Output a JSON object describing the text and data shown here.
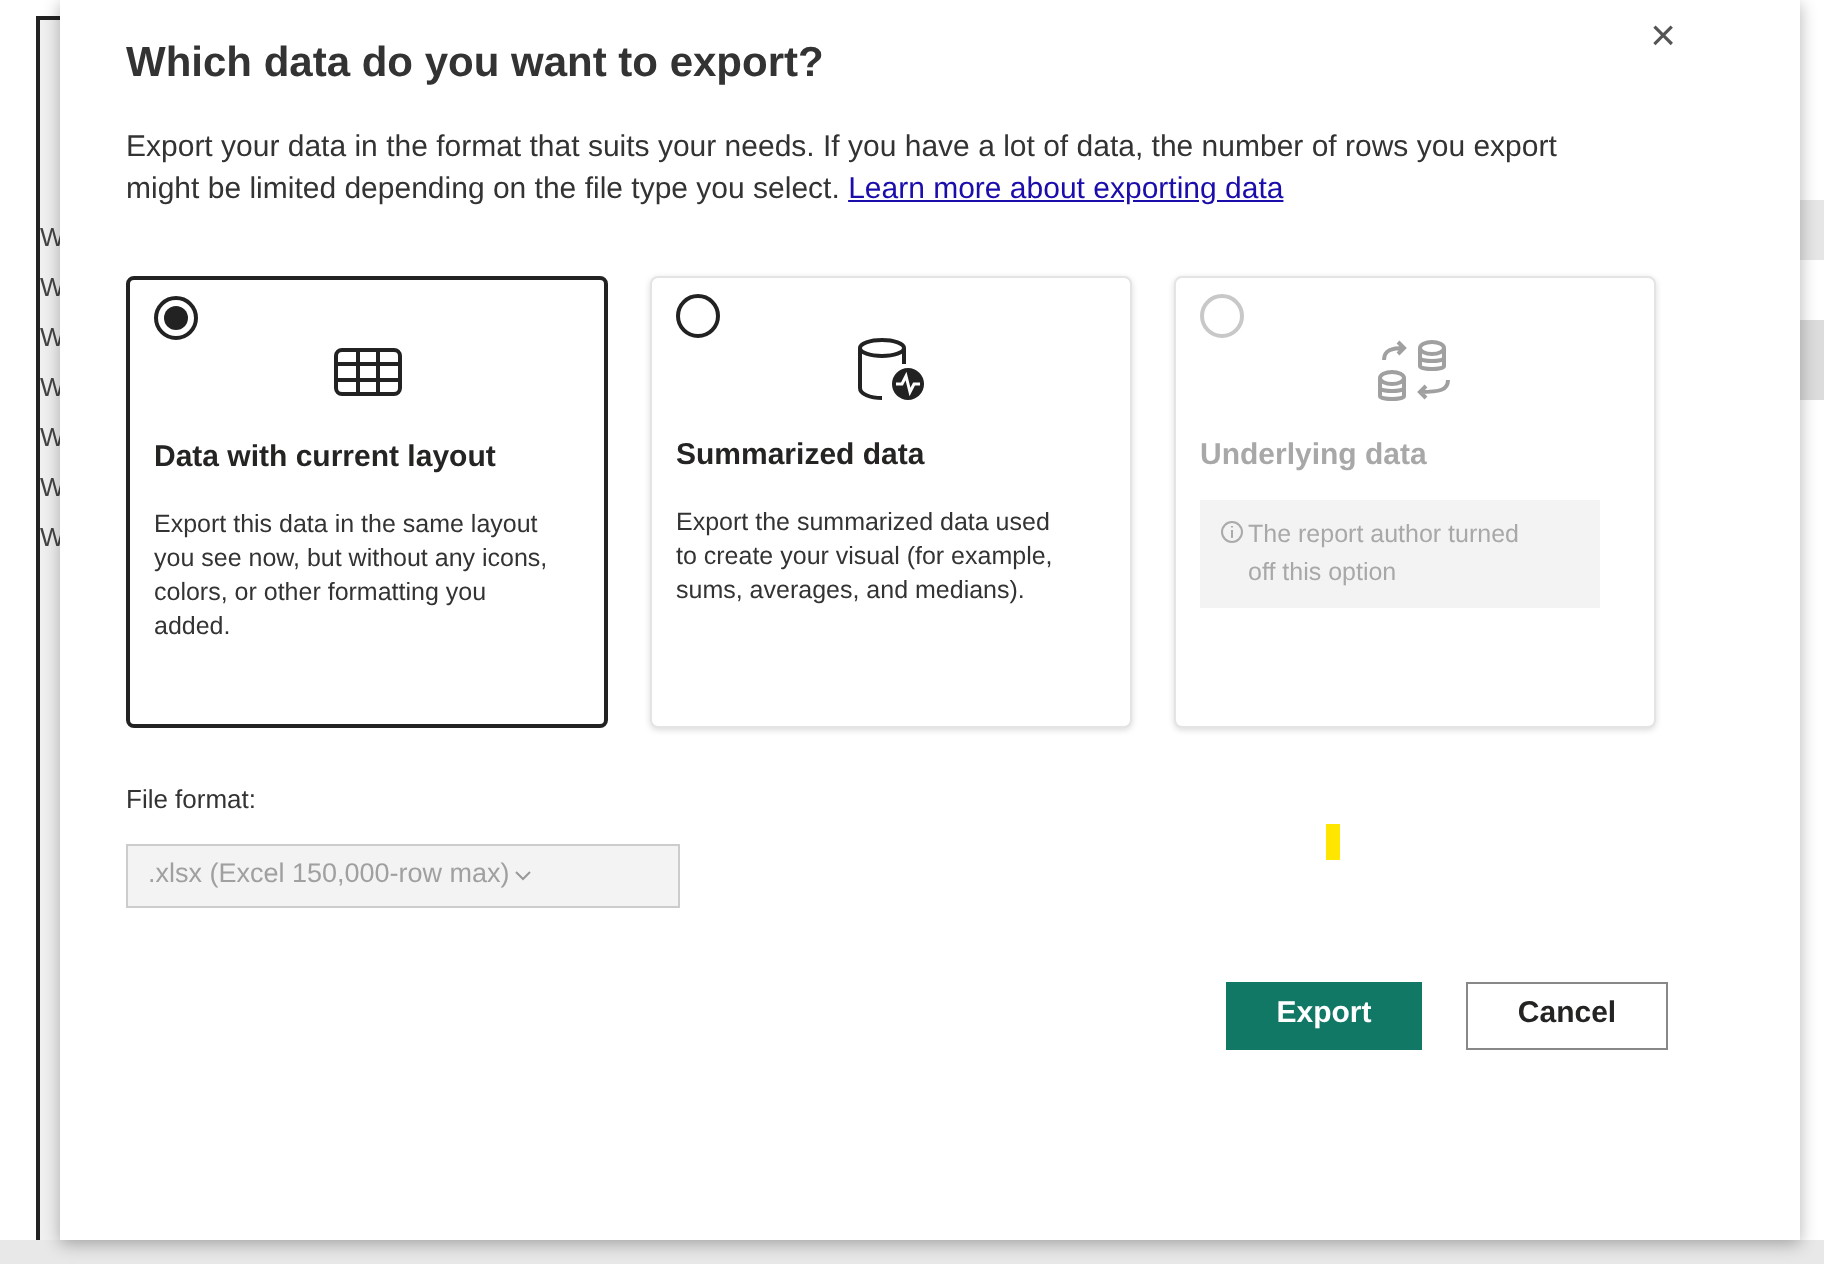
{
  "background": {
    "row_labels": [
      "W",
      "W",
      "W",
      "W",
      "W",
      "W",
      "W"
    ]
  },
  "dialog": {
    "title": "Which data do you want to export?",
    "close": "×",
    "description": "Export your data in the format that suits your needs. If you have a lot of data, the number of rows you export might be limited depending on the file type you select.",
    "link": "Learn more about exporting data",
    "options": [
      {
        "kind": "grid",
        "title": "Data with current layout",
        "description": "Export this data in the same layout you see now, but without any icons, colors, or other formatting you added.",
        "selected": true,
        "disabled": false
      },
      {
        "kind": "database",
        "title": "Summarized data",
        "description": "Export the summarized data used to create your visual (for example, sums, averages, and medians).",
        "selected": false,
        "disabled": false
      },
      {
        "kind": "transfer",
        "title": "Underlying data",
        "notice": "The report author turned off this option",
        "selected": false,
        "disabled": true
      }
    ],
    "file_format": {
      "label": "File format:",
      "value": ".xlsx (Excel 150,000-row max)",
      "disabled": true
    },
    "buttons": [
      {
        "label": "Export",
        "kind": "primary"
      },
      {
        "label": "Cancel",
        "kind": "secondary"
      }
    ]
  }
}
